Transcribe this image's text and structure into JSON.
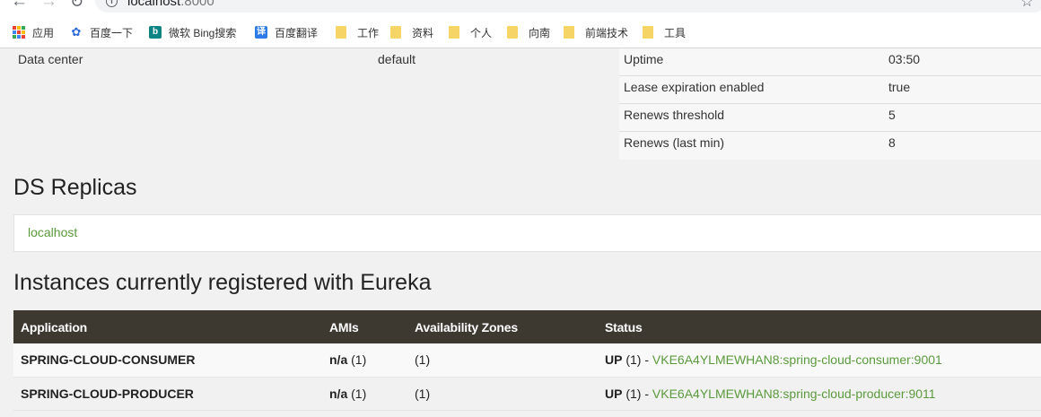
{
  "browser": {
    "url_host": "localhost",
    "url_port": ":8000",
    "bookmarks": [
      {
        "label": "应用",
        "icon": "apps-grid-icon"
      },
      {
        "label": "百度一下",
        "icon": "baidu-paw-icon"
      },
      {
        "label": "微软 Bing搜索",
        "icon": "bing-icon"
      },
      {
        "label": "百度翻译",
        "icon": "translate-icon"
      },
      {
        "label": "工作",
        "icon": "folder-icon"
      },
      {
        "label": "资料",
        "icon": "folder-icon"
      },
      {
        "label": "个人",
        "icon": "folder-icon"
      },
      {
        "label": "向南",
        "icon": "folder-icon"
      },
      {
        "label": "前端技术",
        "icon": "folder-icon"
      },
      {
        "label": "工具",
        "icon": "folder-icon"
      }
    ]
  },
  "general_info": {
    "left": [
      {
        "key": "Data center",
        "value": "default"
      }
    ],
    "right": [
      {
        "key": "Uptime",
        "value": "03:50"
      },
      {
        "key": "Lease expiration enabled",
        "value": "true"
      },
      {
        "key": "Renews threshold",
        "value": "5"
      },
      {
        "key": "Renews (last min)",
        "value": "8"
      }
    ]
  },
  "replicas": {
    "title": "DS Replicas",
    "items": [
      "localhost"
    ]
  },
  "instances": {
    "title": "Instances currently registered with Eureka",
    "headers": [
      "Application",
      "AMIs",
      "Availability Zones",
      "Status"
    ],
    "rows": [
      {
        "application": "SPRING-CLOUD-CONSUMER",
        "amis_bold": "n/a",
        "amis_count": "(1)",
        "zones": "(1)",
        "status_bold": "UP",
        "status_count": "(1) -",
        "instance": "VKE6A4YLMEWHAN8:spring-cloud-consumer:9001"
      },
      {
        "application": "SPRING-CLOUD-PRODUCER",
        "amis_bold": "n/a",
        "amis_count": "(1)",
        "zones": "(1)",
        "status_bold": "UP",
        "status_count": "(1) -",
        "instance": "VKE6A4YLMEWHAN8:spring-cloud-producer:9011"
      }
    ]
  },
  "colors": {
    "link": "#5a9a3c",
    "table_header": "#3d3931",
    "page_bg": "#f1f1f1"
  }
}
